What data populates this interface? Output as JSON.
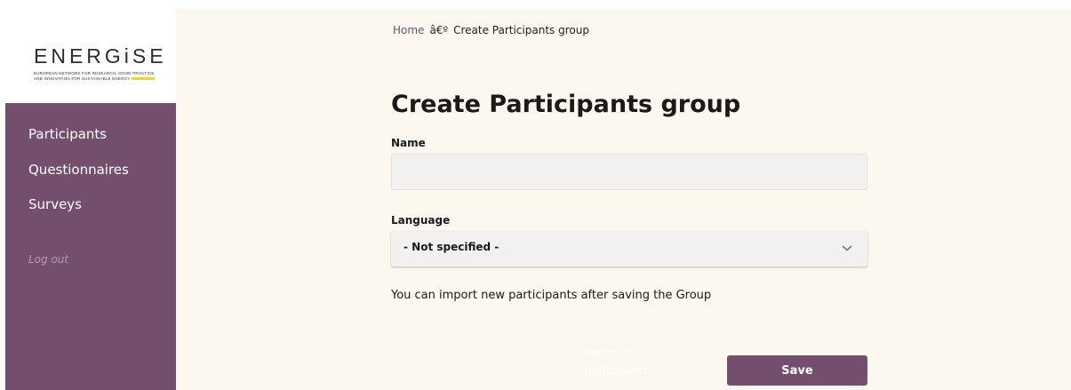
{
  "logo": {
    "wordmark": "ENERGiSE",
    "tagline_line1": "EUROPEAN NETWORK FOR RESEARCH, GOOD PRACTICE",
    "tagline_line2": "AND INNOVATION FOR SUSTAINABLE ENERGY"
  },
  "sidebar": {
    "items": [
      {
        "label": "Participants"
      },
      {
        "label": "Questionnaires"
      },
      {
        "label": "Surveys"
      }
    ],
    "logout_label": "Log out"
  },
  "breadcrumb": {
    "home": "Home",
    "separator": "â€º",
    "current": "Create Participants group"
  },
  "page": {
    "title": "Create Participants group"
  },
  "form": {
    "name_label": "Name",
    "name_value": "",
    "language_label": "Language",
    "language_selected": "- Not specified -",
    "info_text": "You can import new participants after saving the Group",
    "return_label": "Return to participants",
    "save_label": "Save"
  },
  "colors": {
    "brand_purple": "#744e6d",
    "main_background": "#fcf7ef",
    "input_background": "#f2f1f0"
  }
}
